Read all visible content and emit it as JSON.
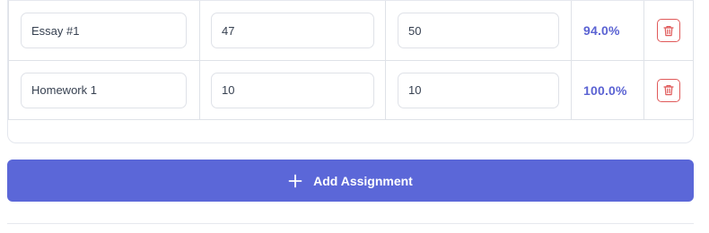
{
  "assignments": [
    {
      "name": "Essay #1",
      "score": "47",
      "total": "50",
      "percent": "94.0%",
      "delete_icon": "trash-icon"
    },
    {
      "name": "Homework 1",
      "score": "10",
      "total": "10",
      "percent": "100.0%",
      "delete_icon": "trash-icon"
    }
  ],
  "add_button": {
    "label": "Add Assignment",
    "icon": "plus-icon"
  },
  "colors": {
    "accent": "#5b67d8",
    "percent_text": "#5b63d3",
    "delete": "#e05a5a"
  }
}
